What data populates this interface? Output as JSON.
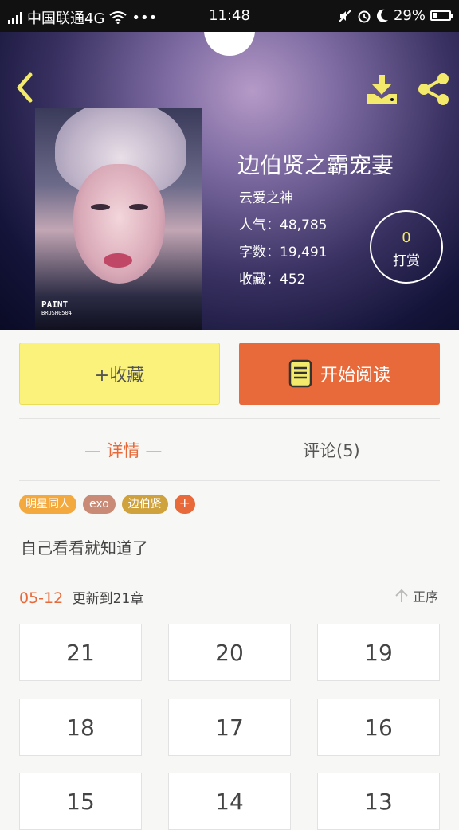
{
  "status_bar": {
    "carrier": "中国联通4G",
    "dots": "•••",
    "time": "11:48",
    "battery": "29%",
    "battery_level": 0.29
  },
  "book": {
    "title": "边伯贤之霸宠妻",
    "author": "云爱之神",
    "popularity": "人气：48,785",
    "word_count": "字数：19,491",
    "favorites": "收藏：452",
    "cover_watermark_1": "PAINT",
    "cover_watermark_2": "BRUSH0504"
  },
  "tip": {
    "count": "0",
    "label": "打赏"
  },
  "actions": {
    "favorite": "+收藏",
    "read": "开始阅读"
  },
  "tabs": {
    "detail": "— 详情 —",
    "comments": "评论(5)"
  },
  "tags": [
    {
      "label": "明星同人",
      "color": "#f3a93d"
    },
    {
      "label": "exo",
      "color": "#c98a76"
    },
    {
      "label": "边伯贤",
      "color": "#cfa23d"
    }
  ],
  "tag_add": "+",
  "description": "自己看看就知道了",
  "update": {
    "date": "05-12",
    "text": "更新到21章"
  },
  "sort_label": "正序",
  "chapters": [
    "21",
    "20",
    "19",
    "18",
    "17",
    "16",
    "15",
    "14",
    "13"
  ],
  "colors": {
    "accent": "#e8693a",
    "favorite_bg": "#fbf27c",
    "icon_yellow": "#f3e96a"
  }
}
